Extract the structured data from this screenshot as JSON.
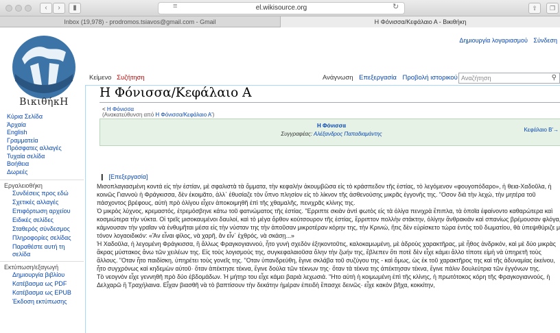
{
  "browser": {
    "url": "el.wikisource.org",
    "tabs": [
      {
        "label": "Inbox (19,978) - prodromos.tsiavos@gmail.com - Gmail"
      },
      {
        "label": "Η Φόνισσα/Κεφάλαιο Α - Βικιθήκη"
      }
    ]
  },
  "account_links": [
    "Δημιουργία λογαριασμού",
    "Σύνδεση"
  ],
  "logo": {
    "wordmark": "ΒικιθήκΗ"
  },
  "sidebar": {
    "nav": [
      "Κύρια Σελίδα",
      "Άρχαία",
      "English",
      "Γραμματεία",
      "Πρόσφατες αλλαγές",
      "Τυχαία σελίδα",
      "Βοήθεια",
      "Δωρεές"
    ],
    "tools_heading": "Εργαλειοθήκη",
    "tools": [
      "Συνδέσεις προς εδώ",
      "Σχετικές αλλαγές",
      "Επιφόρτωση αρχείου",
      "Ειδικές σελίδες",
      "Σταθερός σύνδεσμος",
      "Πληροφορίες σελίδας",
      "Παραθέστε αυτή τη σελίδα"
    ],
    "export_heading": "Εκτύπωση/εξαγωγή",
    "export": [
      "Δημιουργία βιβλίου",
      "Κατέβασμα ως PDF",
      "Κατέβασμα ως EPUB",
      "Έκδοση εκτύπωσης"
    ]
  },
  "namespace_tabs": {
    "page": "Κείμενο",
    "talk": "Συζήτηση"
  },
  "view_tabs": {
    "read": "Ανάγνωση",
    "edit": "Επεξεργασία",
    "history": "Προβολή ιστορικού"
  },
  "search": {
    "placeholder": "Αναζήτηση"
  },
  "page": {
    "title": "Η Φόνισσα/Κεφάλαιο Α",
    "back_prefix": "< ",
    "back_link": "Η Φόνισσα",
    "redirect_prefix": "(Ανακατεύθυνση από ",
    "redirect_link": "Η Φόνισσα/Κεφάλαιο Α'",
    "redirect_suffix": ")"
  },
  "header_box": {
    "work_title": "Η Φόνισσα",
    "author_prefix": "Συγγραφέας: ",
    "author": "Αλέξανδρος Παπαδιαμάντης",
    "next": "Κεφάλαιο Β'→"
  },
  "section_edit": "[Επεξεργασία]",
  "paragraphs": [
    "Μισοπλαγιασμένη κοντά εἰς τὴν ἑστίαν, μὲ σφαλιστὰ τὰ ὄμματα, τὴν κεφαλὴν ἀκουμβῶσα εἰς τὸ κράσπεδον τῆς ἑστίας, τὸ λεγόμενον «φουγοπόδαρο», ἡ θεια-Χαδοῦλα, ἡ κοινῶς Γιαννοὺ ἡ Φράγκισσα, δὲν ἐκοιμᾶτο, ἀλλ᾽ ἐθυσίαζε τὸν ὕπνο πλησίον εἰς τὸ λίκνον τῆς ἀσθενούσης μικρᾶς ἐγγονῆς της. \"Οσον διὰ τὴν λεχώ, τὴν μητέρα τοῦ πάσχοντος βρέφους, αὐτὴ πρὸ ὀλίγου εἶχεν ἀποκοιμηθῆ ἐπὶ τῆς χθαμαλῆς, πενιχρᾶς κλίνης της.",
    "Ὁ μικρὸς λύχνος, κρεμαστός, ἐτρεμόσβηνε κάτω τοῦ φατνώματος τῆς ἑστίας. \"Ερριπτε σκιὰν ἀντὶ φωτὸς εἰς τὰ ὀλίγα πενιχρὰ ἔπιπλα, τὰ ὁποῖα ἐφαίνοντο καθαρώτερα καὶ κοσμιώτερα τὴν νύκτα. Οἱ τρεῖς μισοκαυμένοι δαυλοί, καὶ τὸ μέγα ὄρθον κούτσουρον τῆς ἑστίας, ἔρριπτον πολλὴν στάκτην, ὀλίγην ἄνθρακιὰν καὶ σπανίως βρέμουσαν φλόγα, κάμνουσαν τὴν γραῖαν νὰ ἐνθυμῆται μέσα εἰς τὴν νύσταν της τὴν ἀποῦσαν μικροτέραν κόρην της, τὴν Κρινιώ, ἥτις δὲν εὑρίσκετο τώρα ἐντὸς τοῦ δωματίου, θὰ ὑπεψιθύριζε μὲ τόνον λογαοιδικόν: «Ἂν εἶναι φίλος, νὰ χαρῆ, ἂν εἶν᾽ ἐχθρός, νὰ σκάσῃ...»",
    "Ἡ Χαδοῦλα, ἡ λεγομένη Φράγκισσα, ἢ ἄλλως Φραγκογιαννού, ἦτο γυνὴ σχεδὸν ἑξηκοντοῦτις, καλοκαμωμένη, μὲ ἁδροὺς χαρακτῆρας, μὲ ἦθος ἀνδρικόν, καὶ μὲ δύο μικρὰς ἄκρας μύστακος ἄνω τῶν χειλέων της. Εἰς τοὺς λογισμούς της, συγκεφαλαιοῦσα ὅλην τὴν ζωήν της, ἔβλεπεν ὅτι ποτὲ δὲν εἶχε κάμει ἄλλο τίποτε εἰμὴ νὰ ὑπηρετῆ τοὺς ἄλλους. \"Οταν ἦτο παιδίσκη, ὑπηρέτει τοὺς γονεῖς της. \"Οταν ὑπανδρεύθη, ἔγινε σκλάβα τοῦ συζύγου της - καὶ ὅμως, ὡς ἐκ τοῦ χαρακτῆρος της καὶ τῆς ἀδυναμίας ἐκείνου, ἦτο συγχρόνως καὶ κηδεμὼν αὐτοῦ· ὅταν ἀπέκτησε τέκνα, ἔγινε δούλα τῶν τέκνων της· ὅταν τὰ τέκνα της ἀπέκτησαν τέκνα, ἔγινε πάλιν δουλεύτρια τῶν ἐγγόνων της.",
    "Τὸ νεογνὸν εἶχε γεννηθῆ πρὸ δύο ἑβδομάδων. Ἡ μήτηρ του εἶχε κάμει βαριὰ λεχωσιά. \"Ητο αὐτὴ ἡ κοιμωμένη ἐπὶ τῆς κλίνης, ἡ πρωτότοκος κόρη τῆς Φραγκογιαννούς, ἡ Δελχαρῶ ἢ Τραχήλαινα. Εἶχαν βιασθῆ νὰ τὸ βαπτίσουν τὴν δεκάτην ἡμέραν ἐπειδὴ ἔπασχε δεινῶς· εἶχε κακὸν βῆχα, κοκκίτην,"
  ],
  "colors": {
    "link": "#0645ad",
    "new_link": "#ba0000",
    "header_box_bg": "#e6f2e6"
  }
}
